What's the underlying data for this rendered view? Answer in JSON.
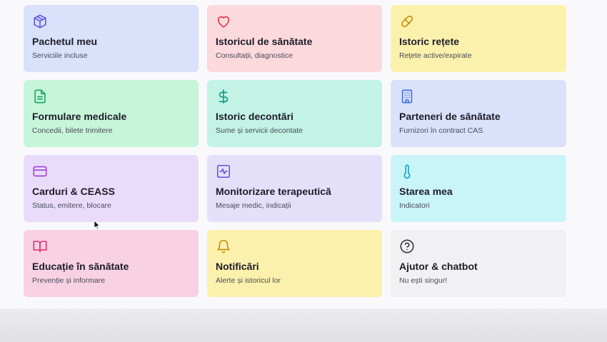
{
  "colors": {
    "blue": "#d9e1fb",
    "red": "#fcd9dc",
    "yellow": "#fbf1ad",
    "green": "#c6f5d9",
    "teal": "#c2f3e5",
    "lavender": "#e9dcfb",
    "purple": "#e4e0fa",
    "cyan": "#c9f5f9",
    "pink": "#f8d2e2",
    "gray": "#f1f1f3"
  },
  "cards": [
    {
      "title": "Pachetul meu",
      "subtitle": "Serviciile incluse",
      "icon": "package-icon"
    },
    {
      "title": "Istoricul de sănătate",
      "subtitle": "Consultații, diagnostice",
      "icon": "heart-icon"
    },
    {
      "title": "Istoric rețete",
      "subtitle": "Rețete active/expirate",
      "icon": "pill-icon"
    },
    {
      "title": "Formulare medicale",
      "subtitle": "Concedii, bilete trimitere",
      "icon": "document-icon"
    },
    {
      "title": "Istoric decontări",
      "subtitle": "Sume și servicii decontate",
      "icon": "dollar-icon"
    },
    {
      "title": "Parteneri de sănătate",
      "subtitle": "Furnizori în contract CAS",
      "icon": "building-icon"
    },
    {
      "title": "Carduri & CEASS",
      "subtitle": "Status, emitere, blocare",
      "icon": "credit-card-icon"
    },
    {
      "title": "Monitorizare terapeutică",
      "subtitle": "Mesaje medic, indicații",
      "icon": "activity-icon"
    },
    {
      "title": "Starea mea",
      "subtitle": "Indicatori",
      "icon": "thermometer-icon"
    },
    {
      "title": "Educație în sănătate",
      "subtitle": "Prevenție și informare",
      "icon": "book-icon"
    },
    {
      "title": "Notificări",
      "subtitle": "Alerte și istoricul lor",
      "icon": "bell-icon"
    },
    {
      "title": "Ajutor & chatbot",
      "subtitle": "Nu ești singur!",
      "icon": "help-circle-icon"
    }
  ]
}
